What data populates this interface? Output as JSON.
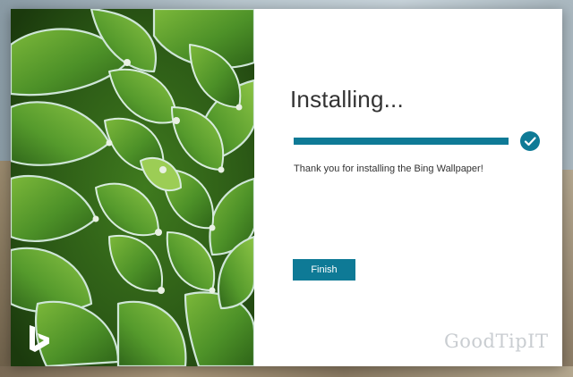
{
  "installer": {
    "title": "Installing...",
    "progress": 1.0,
    "message": "Thank you for installing the Bing Wallpaper!",
    "finish_label": "Finish",
    "status_icon": "check-icon"
  },
  "branding": {
    "logo": "bing-logo-icon",
    "watermark": "GoodTipIT"
  },
  "colors": {
    "accent": "#0e7a96",
    "title_text": "#333333",
    "watermark": "#c9cdd1"
  }
}
